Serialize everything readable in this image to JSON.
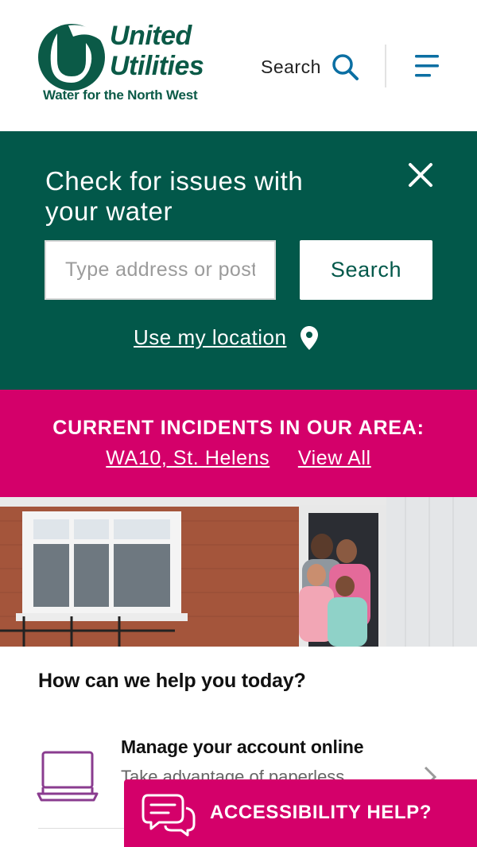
{
  "brand": {
    "name_line1": "United",
    "name_line2": "Utilities",
    "tagline": "Water for the North West",
    "color": "#0b5a47"
  },
  "header": {
    "search_label": "Search",
    "menu_icon": "hamburger-menu-icon"
  },
  "issues": {
    "title": "Check for issues with your water",
    "address_placeholder": "Type address or postcode",
    "search_button": "Search",
    "location_link": "Use my location",
    "background": "#02584a"
  },
  "incidents": {
    "title": "CURRENT INCIDENTS IN OUR AREA:",
    "area_link": "WA10, St. Helens",
    "view_all_link": "View All",
    "background": "#d4006a"
  },
  "help": {
    "title": "How can we help you today?",
    "items": [
      {
        "title": "Manage your account online",
        "description": "Take advantage of paperless",
        "icon": "laptop-icon"
      }
    ]
  },
  "accessibility": {
    "label": "ACCESSIBILITY HELP?",
    "icon": "chat-bubbles-icon"
  }
}
